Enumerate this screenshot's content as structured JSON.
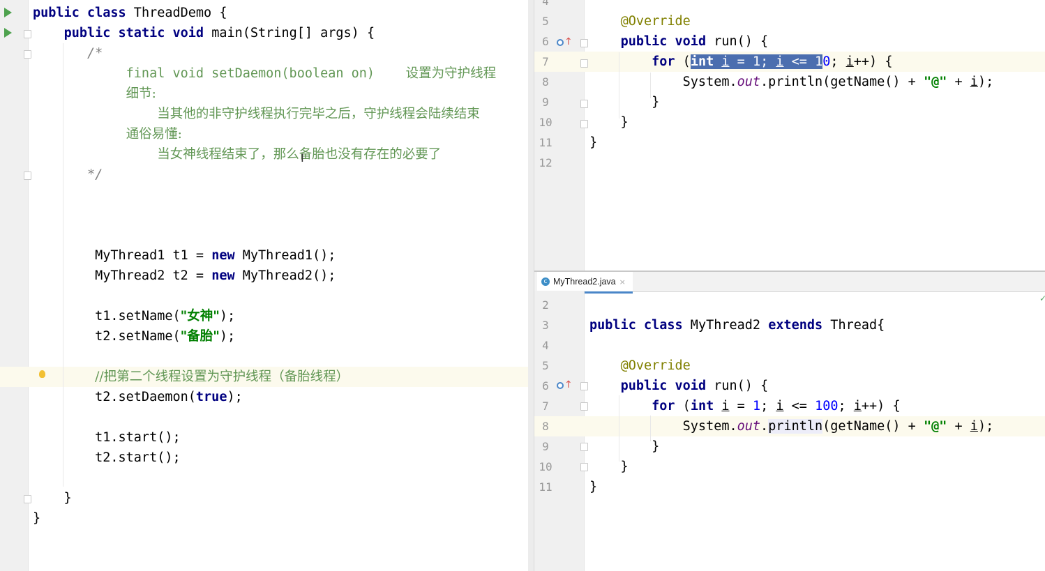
{
  "left_editor": {
    "lines": [
      {
        "parts": [
          [
            "kw",
            "public"
          ],
          [
            "t",
            " "
          ],
          [
            "kw",
            "class"
          ],
          [
            "t",
            " ThreadDemo {"
          ]
        ]
      },
      {
        "parts": [
          [
            "t",
            "    "
          ],
          [
            "kw",
            "public"
          ],
          [
            "t",
            " "
          ],
          [
            "kw",
            "static"
          ],
          [
            "t",
            " "
          ],
          [
            "kw",
            "void"
          ],
          [
            "t",
            " main(String[] args) {"
          ]
        ]
      },
      {
        "parts": [
          [
            "t",
            "       "
          ],
          [
            "cm",
            "/*"
          ]
        ]
      },
      {
        "parts": [
          [
            "t",
            "            "
          ],
          [
            "cmg",
            "final void setDaemon(boolean on)"
          ],
          [
            "t",
            "    "
          ],
          [
            "cmgcn",
            "设置为守护线程"
          ]
        ]
      },
      {
        "parts": [
          [
            "t",
            "            "
          ],
          [
            "cmgcn",
            "细节:"
          ]
        ]
      },
      {
        "parts": [
          [
            "t",
            "                "
          ],
          [
            "cmgcn",
            "当其他的非守护线程执行完毕之后，守护线程会陆续结束"
          ]
        ]
      },
      {
        "parts": [
          [
            "t",
            "            "
          ],
          [
            "cmgcn",
            "通俗易懂:"
          ]
        ]
      },
      {
        "parts": [
          [
            "t",
            "                "
          ],
          [
            "cmgcn",
            "当女神线程结束了，那么备胎也没有存在的必要了"
          ]
        ]
      },
      {
        "parts": [
          [
            "t",
            "       "
          ],
          [
            "cm",
            "*/"
          ]
        ]
      },
      {
        "parts": []
      },
      {
        "parts": []
      },
      {
        "parts": []
      },
      {
        "parts": [
          [
            "t",
            "        MyThread1 t1 = "
          ],
          [
            "kw",
            "new"
          ],
          [
            "t",
            " MyThread1();"
          ]
        ]
      },
      {
        "parts": [
          [
            "t",
            "        MyThread2 t2 = "
          ],
          [
            "kw",
            "new"
          ],
          [
            "t",
            " MyThread2();"
          ]
        ]
      },
      {
        "parts": []
      },
      {
        "parts": [
          [
            "t",
            "        t1.setName("
          ],
          [
            "strcn",
            "\"女神\""
          ],
          [
            "t",
            ");"
          ]
        ]
      },
      {
        "parts": [
          [
            "t",
            "        t2.setName("
          ],
          [
            "strcn",
            "\"备胎\""
          ],
          [
            "t",
            ");"
          ]
        ]
      },
      {
        "parts": []
      },
      {
        "parts": [
          [
            "t",
            "        "
          ],
          [
            "cmgcn",
            "//把第二个线程设置为守护线程（备胎线程）"
          ]
        ]
      },
      {
        "parts": [
          [
            "t",
            "        t2.setDaemon("
          ],
          [
            "kw",
            "true"
          ],
          [
            "t",
            ");"
          ]
        ]
      },
      {
        "parts": []
      },
      {
        "parts": [
          [
            "t",
            "        t1.start();"
          ]
        ]
      },
      {
        "parts": [
          [
            "t",
            "        t2.start();"
          ]
        ]
      },
      {
        "parts": []
      },
      {
        "parts": [
          [
            "t",
            "    }"
          ]
        ]
      },
      {
        "parts": [
          [
            "t",
            "}"
          ]
        ]
      }
    ]
  },
  "top_editor": {
    "line_numbers": [
      "4",
      "5",
      "6",
      "7",
      "8",
      "9",
      "10",
      "11",
      "12"
    ],
    "lines": [
      {
        "parts": []
      },
      {
        "parts": [
          [
            "t",
            "    "
          ],
          [
            "ann",
            "@Override"
          ]
        ]
      },
      {
        "parts": [
          [
            "t",
            "    "
          ],
          [
            "kw",
            "public"
          ],
          [
            "t",
            " "
          ],
          [
            "kw",
            "void"
          ],
          [
            "t",
            " run() {"
          ]
        ]
      },
      {
        "parts": [
          [
            "t",
            "        "
          ],
          [
            "kw",
            "for"
          ],
          [
            "t",
            " ("
          ],
          [
            "selkw",
            "int"
          ],
          [
            "sel",
            " "
          ],
          [
            "selu",
            "i"
          ],
          [
            "sel",
            " = "
          ],
          [
            "selnum",
            "1"
          ],
          [
            "sel",
            "; "
          ],
          [
            "selu",
            "i"
          ],
          [
            "sel",
            " <= "
          ],
          [
            "selnum",
            "1"
          ],
          [
            "num",
            "0"
          ],
          [
            "t",
            "; "
          ],
          [
            "u",
            "i"
          ],
          [
            "t",
            "++) {"
          ]
        ]
      },
      {
        "parts": [
          [
            "t",
            "            System."
          ],
          [
            "fld",
            "out"
          ],
          [
            "t",
            ".println(getName() + "
          ],
          [
            "str",
            "\"@\""
          ],
          [
            "t",
            " + "
          ],
          [
            "u",
            "i"
          ],
          [
            "t",
            ");"
          ]
        ]
      },
      {
        "parts": [
          [
            "t",
            "        }"
          ]
        ]
      },
      {
        "parts": [
          [
            "t",
            "    }"
          ]
        ]
      },
      {
        "parts": [
          [
            "t",
            "}"
          ]
        ]
      },
      {
        "parts": []
      }
    ]
  },
  "tab": {
    "filename": "MyThread2.java",
    "icon": "class-icon",
    "close": "×"
  },
  "bottom_editor": {
    "line_numbers": [
      "2",
      "3",
      "4",
      "5",
      "6",
      "7",
      "8",
      "9",
      "10",
      "11"
    ],
    "lines": [
      {
        "parts": []
      },
      {
        "parts": [
          [
            "kw",
            "public"
          ],
          [
            "t",
            " "
          ],
          [
            "kw",
            "class"
          ],
          [
            "t",
            " MyThread2 "
          ],
          [
            "kw",
            "extends"
          ],
          [
            "t",
            " Thread{"
          ]
        ]
      },
      {
        "parts": []
      },
      {
        "parts": [
          [
            "t",
            "    "
          ],
          [
            "ann",
            "@Override"
          ]
        ]
      },
      {
        "parts": [
          [
            "t",
            "    "
          ],
          [
            "kw",
            "public"
          ],
          [
            "t",
            " "
          ],
          [
            "kw",
            "void"
          ],
          [
            "t",
            " run() {"
          ]
        ]
      },
      {
        "parts": [
          [
            "t",
            "        "
          ],
          [
            "kw",
            "for"
          ],
          [
            "t",
            " ("
          ],
          [
            "kw",
            "int"
          ],
          [
            "t",
            " "
          ],
          [
            "u",
            "i"
          ],
          [
            "t",
            " = "
          ],
          [
            "num",
            "1"
          ],
          [
            "t",
            "; "
          ],
          [
            "u",
            "i"
          ],
          [
            "t",
            " <= "
          ],
          [
            "num",
            "100"
          ],
          [
            "t",
            "; "
          ],
          [
            "u",
            "i"
          ],
          [
            "t",
            "++) {"
          ]
        ]
      },
      {
        "parts": [
          [
            "t",
            "            System."
          ],
          [
            "fld",
            "out"
          ],
          [
            "t",
            "."
          ],
          [
            "pln",
            "println"
          ],
          [
            "t",
            "(getName() + "
          ],
          [
            "str",
            "\"@\""
          ],
          [
            "t",
            " + "
          ],
          [
            "u",
            "i"
          ],
          [
            "t",
            ");"
          ]
        ]
      },
      {
        "parts": [
          [
            "t",
            "        }"
          ]
        ]
      },
      {
        "parts": [
          [
            "t",
            "    }"
          ]
        ]
      },
      {
        "parts": [
          [
            "t",
            "}"
          ]
        ]
      }
    ]
  }
}
